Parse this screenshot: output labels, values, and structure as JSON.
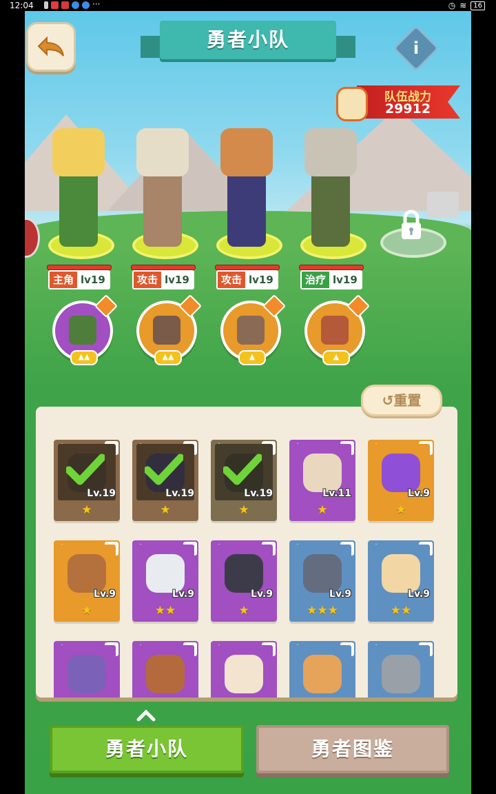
{
  "status_bar": {
    "time": "12:04",
    "more": "···",
    "battery": "16"
  },
  "header": {
    "title": "勇者小队",
    "info_label": "i"
  },
  "team_power": {
    "label": "队伍战力",
    "value": "29912"
  },
  "heroes": [
    {
      "role": "主角",
      "role_color": "#e0572b",
      "level": "lv19"
    },
    {
      "role": "攻击",
      "role_color": "#e0572b",
      "level": "lv19"
    },
    {
      "role": "攻击",
      "role_color": "#e0572b",
      "level": "lv19"
    },
    {
      "role": "治疗",
      "role_color": "#3aa246",
      "level": "lv19"
    }
  ],
  "pets": [
    {
      "bg": "#a14fc1",
      "arrows": "▲▲"
    },
    {
      "bg": "#e89a2a",
      "arrows": "▲▲"
    },
    {
      "bg": "#e89a2a",
      "arrows": "▲"
    },
    {
      "bg": "#e89a2a",
      "arrows": "▲"
    }
  ],
  "reset_label": "重置",
  "cards": [
    {
      "bg": "#8a6a4a",
      "face": "#6d5a45",
      "level": "Lv.19",
      "stars": "★",
      "selected": true
    },
    {
      "bg": "#8a6a4a",
      "face": "#5a5470",
      "level": "Lv.19",
      "stars": "★",
      "selected": true
    },
    {
      "bg": "#7e6e50",
      "face": "#5d5a44",
      "level": "Lv.19",
      "stars": "★",
      "selected": true
    },
    {
      "bg": "#a14fc1",
      "face": "#e9d7c0",
      "level": "Lv.11",
      "stars": "★",
      "selected": false
    },
    {
      "bg": "#e89a2a",
      "face": "#8f4fd6",
      "level": "Lv.9",
      "stars": "★",
      "selected": false
    },
    {
      "bg": "#e89a2a",
      "face": "#b4703d",
      "level": "Lv.9",
      "stars": "★",
      "selected": false
    },
    {
      "bg": "#a14fc1",
      "face": "#e8ecf0",
      "level": "Lv.9",
      "stars": "★★",
      "selected": false
    },
    {
      "bg": "#a14fc1",
      "face": "#3d3b4a",
      "level": "Lv.9",
      "stars": "★",
      "selected": false
    },
    {
      "bg": "#5f90c2",
      "face": "#646c80",
      "level": "Lv.9",
      "stars": "★★★",
      "selected": false
    },
    {
      "bg": "#5f90c2",
      "face": "#f2d6a4",
      "level": "Lv.9",
      "stars": "★★",
      "selected": false
    },
    {
      "bg": "#a14fc1",
      "face": "#7b62b8",
      "level": "",
      "stars": "",
      "selected": false
    },
    {
      "bg": "#a14fc1",
      "face": "#b56a3d",
      "level": "",
      "stars": "",
      "selected": false
    },
    {
      "bg": "#a14fc1",
      "face": "#f3e4d0",
      "level": "",
      "stars": "",
      "selected": false
    },
    {
      "bg": "#5f90c2",
      "face": "#e6a35a",
      "level": "",
      "stars": "",
      "selected": false
    },
    {
      "bg": "#5f90c2",
      "face": "#9aa0a8",
      "level": "",
      "stars": "",
      "selected": false
    }
  ],
  "bottom_buttons": {
    "team": "勇者小队",
    "book": "勇者图鉴"
  }
}
